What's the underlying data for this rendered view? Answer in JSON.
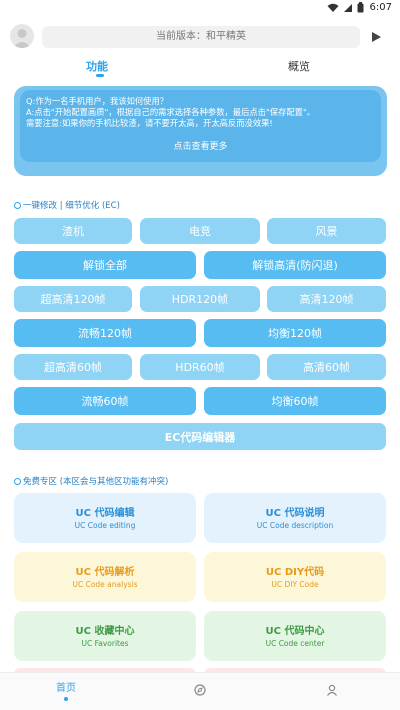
{
  "status_bar": {
    "time": "6:07"
  },
  "header": {
    "version_text": "当前版本：和平精英"
  },
  "tabs": [
    {
      "label": "功能"
    },
    {
      "label": "概览"
    }
  ],
  "notice": {
    "text": "Q:作为一名手机用户，我该如何使用？\nA:点击\"开始配置画质\"，根据自己的需求选择各种参数，最后点击\"保存配置\"。\n需要注意:如果你的手机比较渣，请不要开太高，开太高反而没效果!",
    "more_label": "点击查看更多"
  },
  "section_one": {
    "title": "一键修改 | 细节优化 (EC)",
    "row1": [
      "渣机",
      "电竞",
      "风景"
    ],
    "row2": [
      "解锁全部",
      "解锁高清(防闪退)"
    ],
    "row3": [
      "超高清120帧",
      "HDR120帧",
      "高清120帧"
    ],
    "row4": [
      "流畅120帧",
      "均衡120帧"
    ],
    "row5": [
      "超高清60帧",
      "HDR60帧",
      "高清60帧"
    ],
    "row6": [
      "流畅60帧",
      "均衡60帧"
    ],
    "editor_label": "EC代码编辑器"
  },
  "section_two": {
    "title": "免费专区 (本区会与其他区功能有冲突)",
    "cards": [
      {
        "title": "UC 代码编辑",
        "subtitle": "UC Code editing"
      },
      {
        "title": "UC 代码说明",
        "subtitle": "UC Code description"
      },
      {
        "title": "UC 代码解析",
        "subtitle": "UC Code analysis"
      },
      {
        "title": "UC DIY代码",
        "subtitle": "UC DIY Code"
      },
      {
        "title": "UC 收藏中心",
        "subtitle": "UC Favorites"
      },
      {
        "title": "UC 代码中心",
        "subtitle": "UC Code center"
      }
    ]
  },
  "bottom_nav": {
    "home_label": "首页",
    "icons": [
      "compass-icon",
      "user-icon"
    ]
  },
  "colors": {
    "accent": "#2da3ee",
    "button_light": "#8fd3f5",
    "button_mid": "#57bcf2",
    "notice_bg": "#7ac5ef"
  }
}
